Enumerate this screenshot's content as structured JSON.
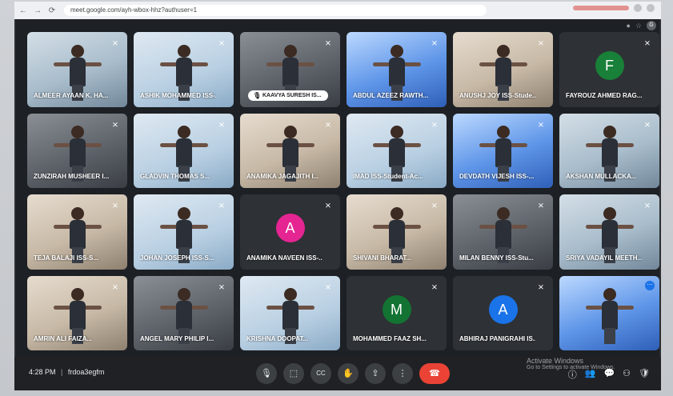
{
  "browser": {
    "back_icon": "←",
    "forward_icon": "→",
    "reload_icon": "⟳",
    "url": "meet.google.com/ayh-wbox-hhz?authuser=1",
    "profile_initial": "G"
  },
  "tiles": [
    {
      "name": "ALMEER AYAAN K. HA...",
      "style": "video cool"
    },
    {
      "name": "ASHIK MOHAMMED ISS-...",
      "style": "video sky"
    },
    {
      "name": "KAAVYA SURESH IS...",
      "style": "video dark",
      "pill": true
    },
    {
      "name": "ABDUL AZEEZ RAWTH...",
      "style": "video blue"
    },
    {
      "name": "ANUSHJ JOY ISS-Stude...",
      "style": "video warm"
    },
    {
      "name": "FAYROUZ AHMED RAG...",
      "style": "avatar",
      "initial": "F",
      "color": "#188038"
    },
    {
      "name": "ZUNZIRAH MUSHEER I...",
      "style": "video dark"
    },
    {
      "name": "GLADVIN THOMAS S...",
      "style": "video sky"
    },
    {
      "name": "ANAMIKA JAGAJITH I...",
      "style": "video warm"
    },
    {
      "name": "IMAD ISS-Student-Ac...",
      "style": "video sky"
    },
    {
      "name": "DEVDATH VIJESH ISS-...",
      "style": "video blue"
    },
    {
      "name": "AKSHAN MULLACKA...",
      "style": "video cool"
    },
    {
      "name": "TEJA BALAJI ISS-S...",
      "style": "video warm"
    },
    {
      "name": "JOHAN JOSEPH ISS-S...",
      "style": "video sky"
    },
    {
      "name": "ANAMIKA NAVEEN ISS-...",
      "style": "avatar",
      "initial": "A",
      "color": "#e52592"
    },
    {
      "name": "SHIVANI BHARAT...",
      "style": "video warm"
    },
    {
      "name": "MILAN BENNY ISS-Stu...",
      "style": "video dark"
    },
    {
      "name": "SRIYA VADAYIL MEETH...",
      "style": "video cool"
    },
    {
      "name": "AMRIN ALI FAIZA...",
      "style": "video warm"
    },
    {
      "name": "ANGEL MARY PHILIP I...",
      "style": "video dark"
    },
    {
      "name": "KRISHNA DOOPAT...",
      "style": "video sky"
    },
    {
      "name": "MOHAMMED FAAZ SH...",
      "style": "avatar",
      "initial": "M",
      "color": "#137333"
    },
    {
      "name": "ABHIRAJ PANIGRAHI IS...",
      "style": "avatar",
      "initial": "A",
      "color": "#1a73e8"
    },
    {
      "name": "",
      "style": "video blue",
      "self": true
    }
  ],
  "bottom": {
    "time": "4:28 PM",
    "separator": "|",
    "meeting_code": "frdoa3egfm",
    "controls": {
      "mic_icon": "🎙",
      "camera_icon": "⬚",
      "captions_icon": "CC",
      "raise_hand_icon": "✋",
      "present_icon": "⇪",
      "more_icon": "⋮",
      "end_call_icon": "☎"
    },
    "right": {
      "info_icon": "ⓘ",
      "people_icon": "👥",
      "chat_icon": "💬",
      "activities_icon": "⚇",
      "host_controls_icon": "🛡"
    }
  },
  "windows_watermark": {
    "line1": "Activate Windows",
    "line2": "Go to Settings to activate Windows."
  },
  "colors": {
    "meet_background": "#202124",
    "end_call_red": "#ea4335"
  }
}
